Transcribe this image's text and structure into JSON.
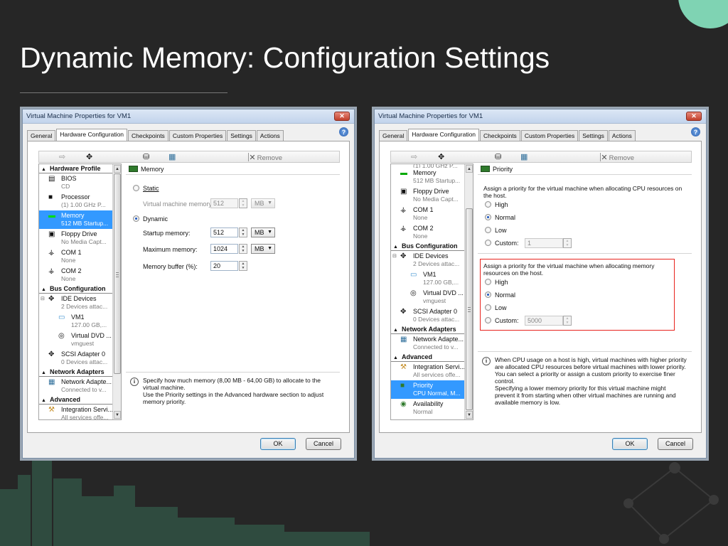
{
  "slide": {
    "title": "Dynamic Memory: Configuration Settings"
  },
  "dialogs": [
    {
      "title": "Virtual Machine Properties for VM1",
      "close_glyph": "✕",
      "tabs": [
        "General",
        "Hardware Configuration",
        "Checkpoints",
        "Custom Properties",
        "Settings",
        "Actions"
      ],
      "toolbar": {
        "remove_label": "Remove"
      },
      "hardware_list": {
        "hardware_profile": "Hardware Profile",
        "bios": {
          "name": "BIOS",
          "sub": "CD"
        },
        "processor": {
          "name": "Processor",
          "sub": "(1) 1.00 GHz P..."
        },
        "memory": {
          "name": "Memory",
          "sub": "512 MB Startup..."
        },
        "floppy": {
          "name": "Floppy Drive",
          "sub": "No Media Capt..."
        },
        "com1": {
          "name": "COM 1",
          "sub": "None"
        },
        "com2": {
          "name": "COM 2",
          "sub": "None"
        },
        "bus_configuration": "Bus Configuration",
        "ide": {
          "name": "IDE Devices",
          "sub": "2 Devices attac..."
        },
        "vm1": {
          "name": "VM1",
          "sub": "127.00 GB,..."
        },
        "dvd": {
          "name": "Virtual DVD ...",
          "sub": "vmguest"
        },
        "scsi": {
          "name": "SCSI Adapter 0",
          "sub": "0 Devices attac..."
        },
        "network_adapters": "Network Adapters",
        "netadapter": {
          "name": "Network Adapte...",
          "sub": "Connected to v..."
        },
        "advanced": "Advanced",
        "integration": {
          "name": "Integration Servi...",
          "sub": "All services offe..."
        }
      },
      "detail": {
        "header": "Memory",
        "static_label": "Static",
        "vm_memory_label": "Virtual machine memory:",
        "vm_memory_value": "512",
        "vm_memory_unit": "MB",
        "dynamic_label": "Dynamic",
        "startup_label": "Startup memory:",
        "startup_value": "512",
        "startup_unit": "MB",
        "maximum_label": "Maximum memory:",
        "maximum_value": "1024",
        "maximum_unit": "MB",
        "buffer_label": "Memory buffer (%):",
        "buffer_value": "20",
        "info_text": "Specify how much memory (8,00 MB - 64,00 GB) to allocate to the virtual machine.\nUse the Priority settings in the Advanced hardware section to adjust memory priority."
      },
      "buttons": {
        "ok": "OK",
        "cancel": "Cancel"
      }
    },
    {
      "title": "Virtual Machine Properties for VM1",
      "close_glyph": "✕",
      "tabs": [
        "General",
        "Hardware Configuration",
        "Checkpoints",
        "Custom Properties",
        "Settings",
        "Actions"
      ],
      "toolbar": {
        "remove_label": "Remove"
      },
      "hardware_list": {
        "processor_partial": "(1) 1.00 GHz P...",
        "memory": {
          "name": "Memory",
          "sub": "512 MB Startup..."
        },
        "floppy": {
          "name": "Floppy Drive",
          "sub": "No Media Capt..."
        },
        "com1": {
          "name": "COM 1",
          "sub": "None"
        },
        "com2": {
          "name": "COM 2",
          "sub": "None"
        },
        "bus_configuration": "Bus Configuration",
        "ide": {
          "name": "IDE Devices",
          "sub": "2 Devices attac..."
        },
        "vm1": {
          "name": "VM1",
          "sub": "127.00 GB,..."
        },
        "dvd": {
          "name": "Virtual DVD ...",
          "sub": "vmguest"
        },
        "scsi": {
          "name": "SCSI Adapter 0",
          "sub": "0 Devices attac..."
        },
        "network_adapters": "Network Adapters",
        "netadapter": {
          "name": "Network Adapte...",
          "sub": "Connected to v..."
        },
        "advanced": "Advanced",
        "integration": {
          "name": "Integration Servi...",
          "sub": "All services offe..."
        },
        "priority": {
          "name": "Priority",
          "sub": "CPU Normal, M..."
        },
        "availability": {
          "name": "Availability",
          "sub": "Normal"
        }
      },
      "detail": {
        "header": "Priority",
        "cpu_desc": "Assign a priority for the virtual machine when allocating CPU resources on the host.",
        "cpu_high": "High",
        "cpu_normal": "Normal",
        "cpu_low": "Low",
        "cpu_custom": "Custom:",
        "cpu_custom_value": "1",
        "mem_desc": "Assign a priority for the virtual machine when allocating memory resources on the host.",
        "mem_high": "High",
        "mem_normal": "Normal",
        "mem_low": "Low",
        "mem_custom": "Custom:",
        "mem_custom_value": "5000",
        "info_text": "When CPU usage on a host is high, virtual machines with higher priority are allocated CPU resources before virtual machines with lower priority. You can select a priority or assign a custom priority to exercise finer control.\nSpecifying a lower memory priority for this virtual machine might prevent it from starting when other virtual machines are running and available memory is low."
      },
      "buttons": {
        "ok": "OK",
        "cancel": "Cancel"
      }
    }
  ],
  "colors": {
    "accent_circle": "#7fd3b3",
    "selection": "#3399ff",
    "highlight_box": "#e8231d"
  }
}
